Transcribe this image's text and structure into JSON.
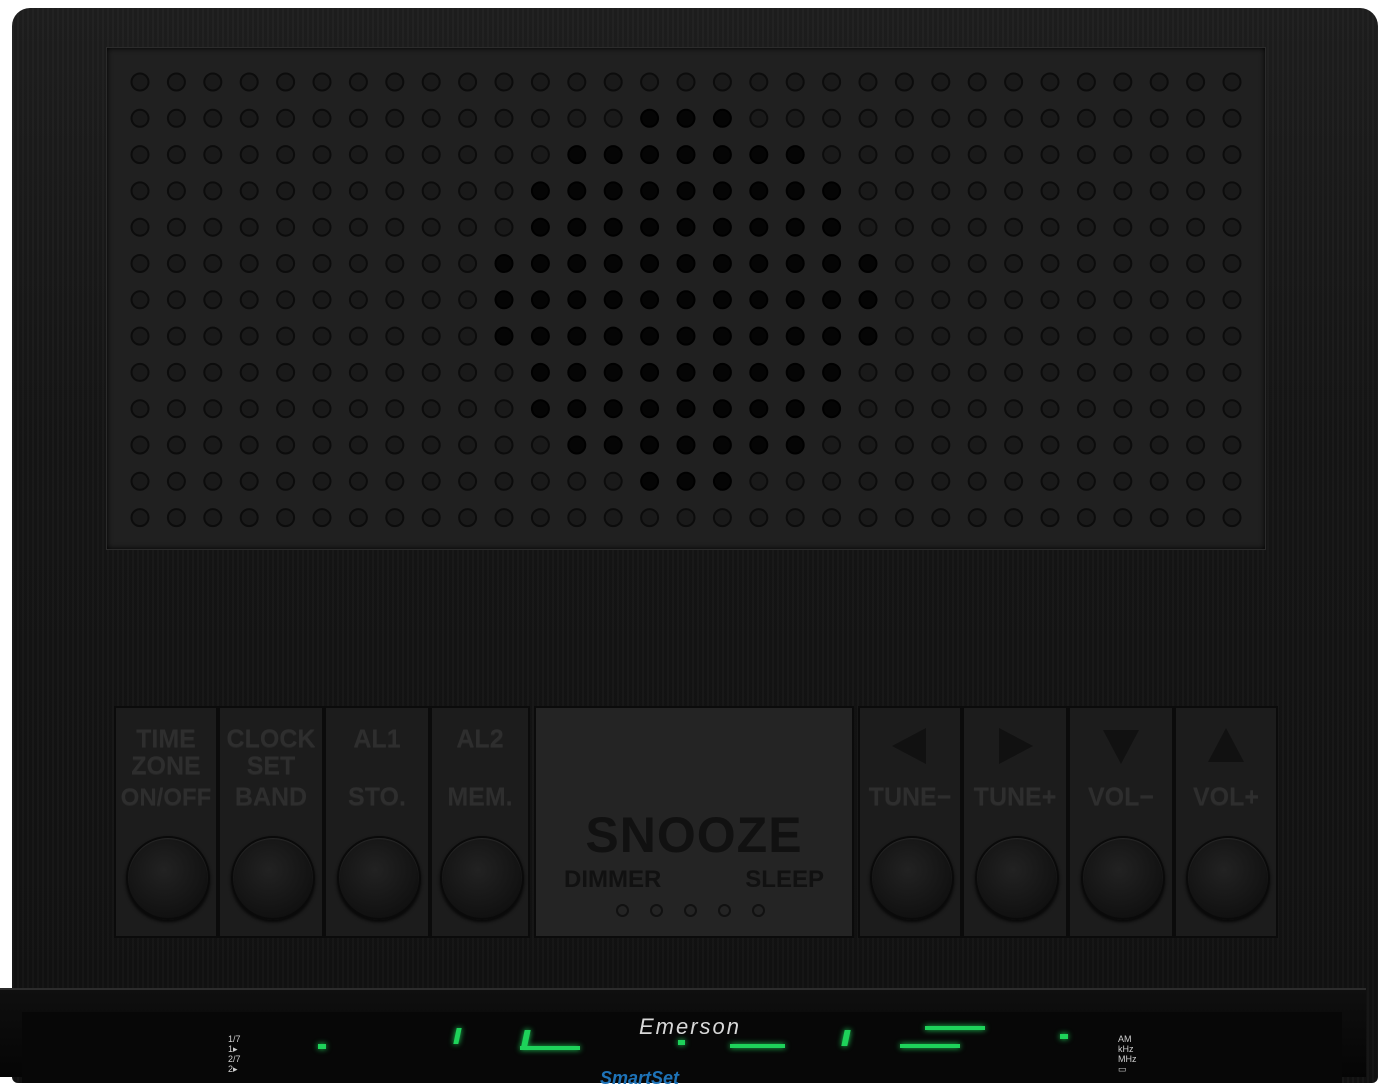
{
  "product": {
    "brand": "Emerson",
    "sub_brand": "SmartSet"
  },
  "buttons": [
    {
      "id": "time-zone",
      "lines": [
        "TIME",
        "ZONE",
        "ON/OFF"
      ]
    },
    {
      "id": "clock-set",
      "lines": [
        "CLOCK",
        "SET",
        "BAND"
      ]
    },
    {
      "id": "al1",
      "lines": [
        "AL1",
        "",
        "STO."
      ]
    },
    {
      "id": "al2",
      "lines": [
        "AL2",
        "",
        "MEM."
      ]
    }
  ],
  "right_buttons": [
    {
      "id": "tune-minus",
      "label": "TUNE−",
      "arrow": "left"
    },
    {
      "id": "tune-plus",
      "label": "TUNE+",
      "arrow": "right"
    },
    {
      "id": "vol-minus",
      "label": "VOL−",
      "arrow": "down"
    },
    {
      "id": "vol-plus",
      "label": "VOL+",
      "arrow": "up"
    }
  ],
  "snooze": {
    "title": "SNOOZE",
    "left": "DIMMER",
    "right": "SLEEP"
  },
  "display": {
    "indicators_left": [
      "1/7",
      "1▸",
      "2/7",
      "2▸"
    ],
    "indicators_right": [
      "AM",
      "kHz",
      "MHz",
      "▭"
    ]
  },
  "colors": {
    "body": "#151515",
    "display_green": "#1ed25a",
    "smartset_blue": "#1e73b8"
  }
}
